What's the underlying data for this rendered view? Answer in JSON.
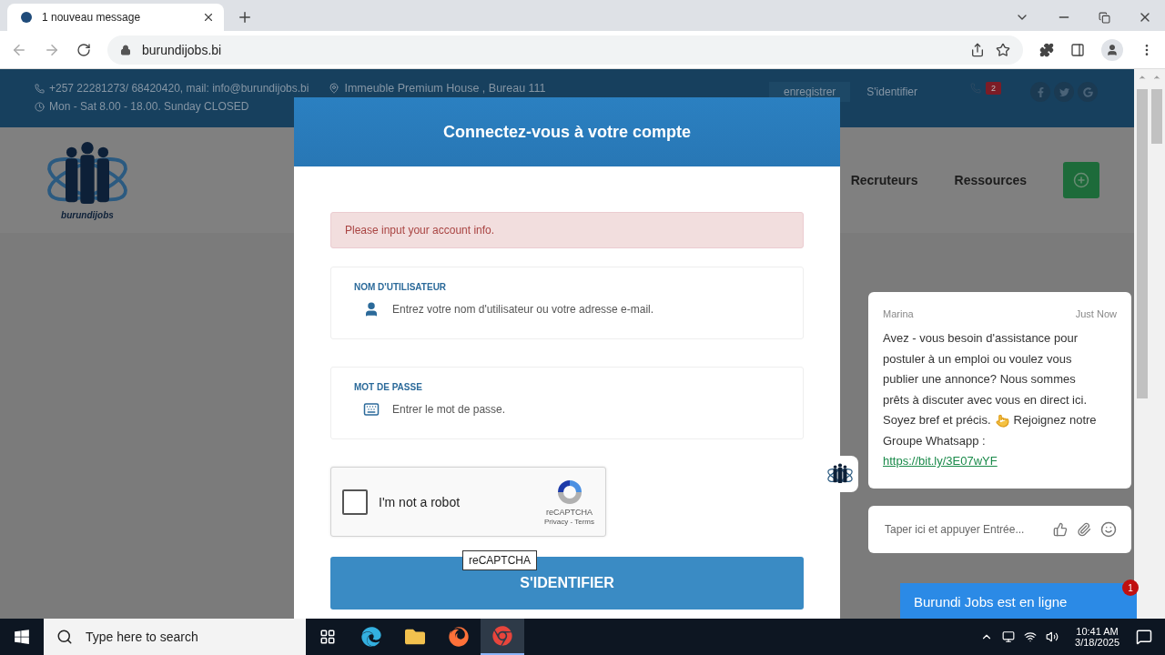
{
  "browser": {
    "tab_title": "1 nouveau message",
    "url": "burundijobs.bi"
  },
  "topbar": {
    "contact": "+257 22281273/ 68420420, mail: info@burundijobs.bi",
    "hours": "Mon - Sat 8.00 - 18.00. Sunday CLOSED",
    "address": "Immeuble Premium House , Bureau 111",
    "register": "enregistrer",
    "login": "S'identifier",
    "notif_count": "2"
  },
  "header": {
    "logo_text": "burundijobs",
    "nav": [
      "Recruteurs",
      "Ressources"
    ]
  },
  "modal": {
    "title": "Connectez-vous à votre compte",
    "alert": "Please input your account info.",
    "fields": [
      {
        "kind": "user",
        "label": "NOM D'UTILISATEUR",
        "placeholder": "Entrez votre nom d'utilisateur ou votre adresse e-mail."
      },
      {
        "kind": "password",
        "label": "MOT DE PASSE",
        "placeholder": "Entrer le mot de passe."
      }
    ],
    "captcha": {
      "label": "I'm not a robot",
      "checked": false,
      "brand": "reCAPTCHA",
      "privacy": "Privacy",
      "separator": " - ",
      "terms": "Terms",
      "tooltip": "reCAPTCHA"
    },
    "submit": "S'IDENTIFIER"
  },
  "chat": {
    "sender": "Marina",
    "time": "Just Now",
    "message_lines": [
      {
        "kind": "text",
        "text": "Avez - vous besoin d'assistance pour"
      },
      {
        "kind": "text",
        "text": "postuler à un emploi ou voulez vous"
      },
      {
        "kind": "text",
        "text": "publier une annonce? Nous sommes"
      },
      {
        "kind": "text",
        "text": "prêts à discuter avec vous en direct ici."
      },
      {
        "kind": "pointer",
        "text": "Soyez bref et précis.",
        "after": "Rejoignez notre"
      },
      {
        "kind": "text",
        "text": "Groupe Whatsapp :"
      }
    ],
    "link": "https://bit.ly/3E07wYF",
    "placeholder": "Taper ici et appuyer Entrée...",
    "status": "Burundi Jobs est en ligne",
    "badge": "1"
  },
  "taskbar": {
    "search_placeholder": "Type here to search",
    "time": "10:41 AM",
    "date": "3/18/2025"
  }
}
